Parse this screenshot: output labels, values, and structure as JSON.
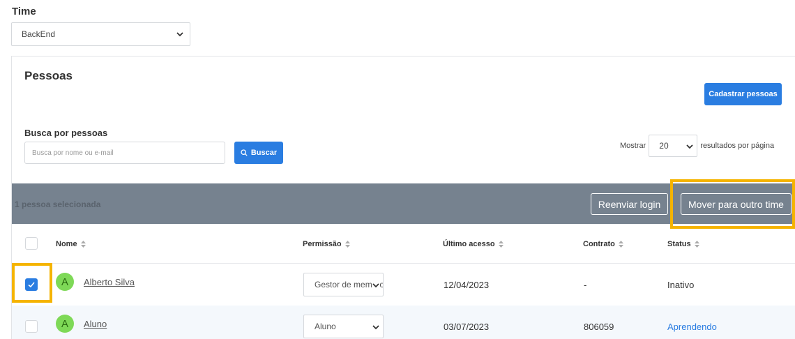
{
  "team": {
    "label": "Time",
    "selected": "BackEnd"
  },
  "people": {
    "title": "Pessoas",
    "register_button": "Cadastrar pessoas",
    "search": {
      "label": "Busca por pessoas",
      "placeholder": "Busca por nome ou e-mail",
      "button": "Buscar"
    },
    "pagination": {
      "prefix": "Mostrar",
      "per_page": "20",
      "suffix": "resultados por página"
    }
  },
  "selection_bar": {
    "text": "1 pessoa selecionada",
    "resend_button": "Reenviar login",
    "move_button": "Mover para outro time"
  },
  "table": {
    "columns": [
      "Nome",
      "Permissão",
      "Último acesso",
      "Contrato",
      "Status"
    ],
    "rows": [
      {
        "initial": "A",
        "name": "Alberto Silva",
        "permission": "Gestor de membros",
        "last_access": "12/04/2023",
        "contract": "-",
        "status": "Inativo",
        "checked": true
      },
      {
        "initial": "A",
        "name": "Aluno",
        "permission": "Aluno",
        "last_access": "03/07/2023",
        "contract": "806059",
        "status": "Aprendendo",
        "checked": false
      }
    ]
  },
  "colors": {
    "primary": "#2a7de1",
    "selection_bar": "#76828f",
    "highlight": "#f5b400",
    "avatar": "#7ed957"
  }
}
